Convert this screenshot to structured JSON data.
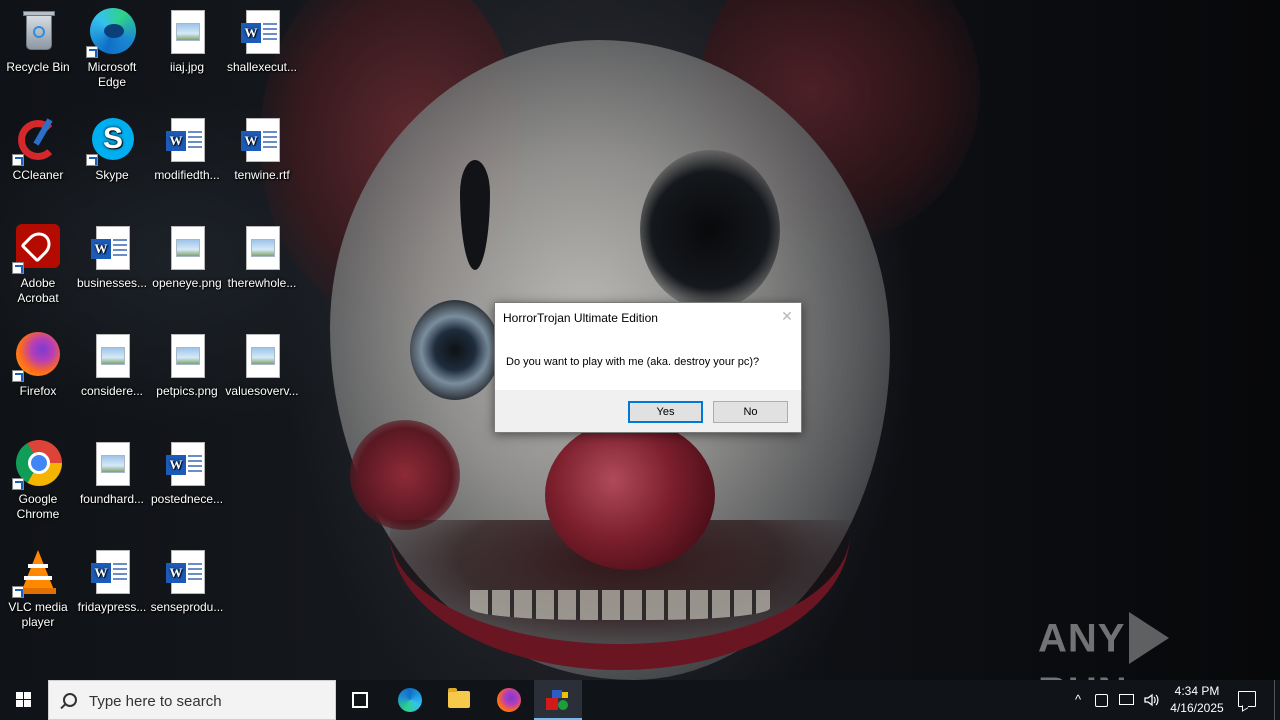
{
  "desktop": {
    "icons": [
      {
        "label": "Recycle Bin",
        "icon": "recycle-bin-icon"
      },
      {
        "label": "Microsoft Edge",
        "icon": "edge-icon"
      },
      {
        "label": "iiaj.jpg",
        "icon": "image-file-icon"
      },
      {
        "label": "shallexecut...",
        "icon": "word-doc-icon"
      },
      {
        "label": "CCleaner",
        "icon": "ccleaner-icon"
      },
      {
        "label": "Skype",
        "icon": "skype-icon"
      },
      {
        "label": "modifiedth...",
        "icon": "word-doc-icon"
      },
      {
        "label": "tenwine.rtf",
        "icon": "word-doc-icon"
      },
      {
        "label": "Adobe Acrobat",
        "icon": "acrobat-icon"
      },
      {
        "label": "businesses...",
        "icon": "word-doc-icon"
      },
      {
        "label": "openeye.png",
        "icon": "image-file-icon"
      },
      {
        "label": "therewhole...",
        "icon": "image-file-icon"
      },
      {
        "label": "Firefox",
        "icon": "firefox-icon"
      },
      {
        "label": "considere...",
        "icon": "image-file-icon"
      },
      {
        "label": "petpics.png",
        "icon": "image-file-icon"
      },
      {
        "label": "valuesoverv...",
        "icon": "image-file-icon"
      },
      {
        "label": "Google Chrome",
        "icon": "chrome-icon"
      },
      {
        "label": "foundhard...",
        "icon": "image-file-icon"
      },
      {
        "label": "postednece...",
        "icon": "word-doc-icon"
      },
      {
        "label": "VLC media player",
        "icon": "vlc-icon"
      },
      {
        "label": "fridaypress...",
        "icon": "word-doc-icon"
      },
      {
        "label": "senseprodu...",
        "icon": "word-doc-icon"
      }
    ]
  },
  "dialog": {
    "title": "HorrorTrojan Ultimate Edition",
    "close_glyph": "✕",
    "message": "Do you want to play with me (aka. destroy your pc)?",
    "yes_label": "Yes",
    "no_label": "No"
  },
  "watermark": {
    "left": "ANY",
    "right": "RUN"
  },
  "taskbar": {
    "search_placeholder": "Type here to search",
    "time": "4:34 PM",
    "date": "4/16/2025",
    "pinned": [
      "task-view-icon",
      "edge-icon",
      "file-explorer-icon",
      "firefox-icon",
      "horrortrojan-icon"
    ],
    "tray_chevron": "^"
  },
  "colors": {
    "taskbar_bg": "#101318",
    "accent": "#0078d7",
    "active_indicator": "#76b9ed"
  }
}
